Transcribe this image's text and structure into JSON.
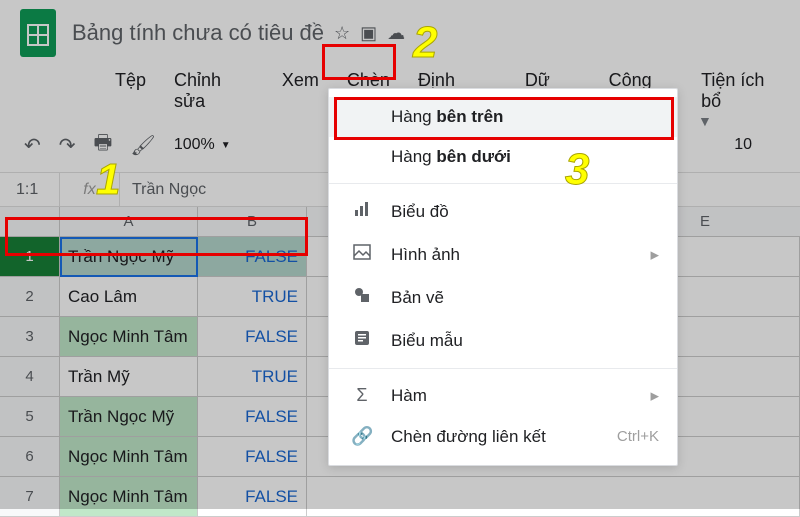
{
  "doc": {
    "title": "Bảng tính chưa có tiêu đề"
  },
  "menubar": {
    "file": "Tệp",
    "edit": "Chỉnh sửa",
    "view": "Xem",
    "insert": "Chèn",
    "format": "Định dạng",
    "data": "Dữ liệu",
    "tools": "Công cụ",
    "extensions": "Tiện ích bổ"
  },
  "toolbar": {
    "zoom": "100%",
    "right_value": "10"
  },
  "name_box": "1:1",
  "formula_bar": "Trần Ngọc",
  "columns": {
    "a": "A",
    "b": "B",
    "e": "E"
  },
  "rows": [
    {
      "n": "1",
      "a": "Trần Ngọc Mỹ",
      "b": "FALSE",
      "hl": true
    },
    {
      "n": "2",
      "a": "Cao Lâm",
      "b": "TRUE",
      "hl": false
    },
    {
      "n": "3",
      "a": "Ngọc Minh Tâm",
      "b": "FALSE",
      "hl": true
    },
    {
      "n": "4",
      "a": "Trần Mỹ",
      "b": "TRUE",
      "hl": false
    },
    {
      "n": "5",
      "a": "Trần Ngọc Mỹ",
      "b": "FALSE",
      "hl": true
    },
    {
      "n": "6",
      "a": "Ngọc Minh Tâm",
      "b": "FALSE",
      "hl": true
    },
    {
      "n": "7",
      "a": "Ngọc Minh Tâm",
      "b": "FALSE",
      "hl": true
    }
  ],
  "menu": {
    "row_above_pre": "Hàng ",
    "row_above_bold": "bên trên",
    "row_below_pre": "Hàng ",
    "row_below_bold": "bên dưới",
    "chart": "Biểu đồ",
    "image": "Hình ảnh",
    "drawing": "Bản vẽ",
    "form": "Biểu mẫu",
    "function": "Hàm",
    "link": "Chèn đường liên kết",
    "link_shortcut": "Ctrl+K"
  },
  "annotations": {
    "n1": "1",
    "n2": "2",
    "n3": "3"
  }
}
